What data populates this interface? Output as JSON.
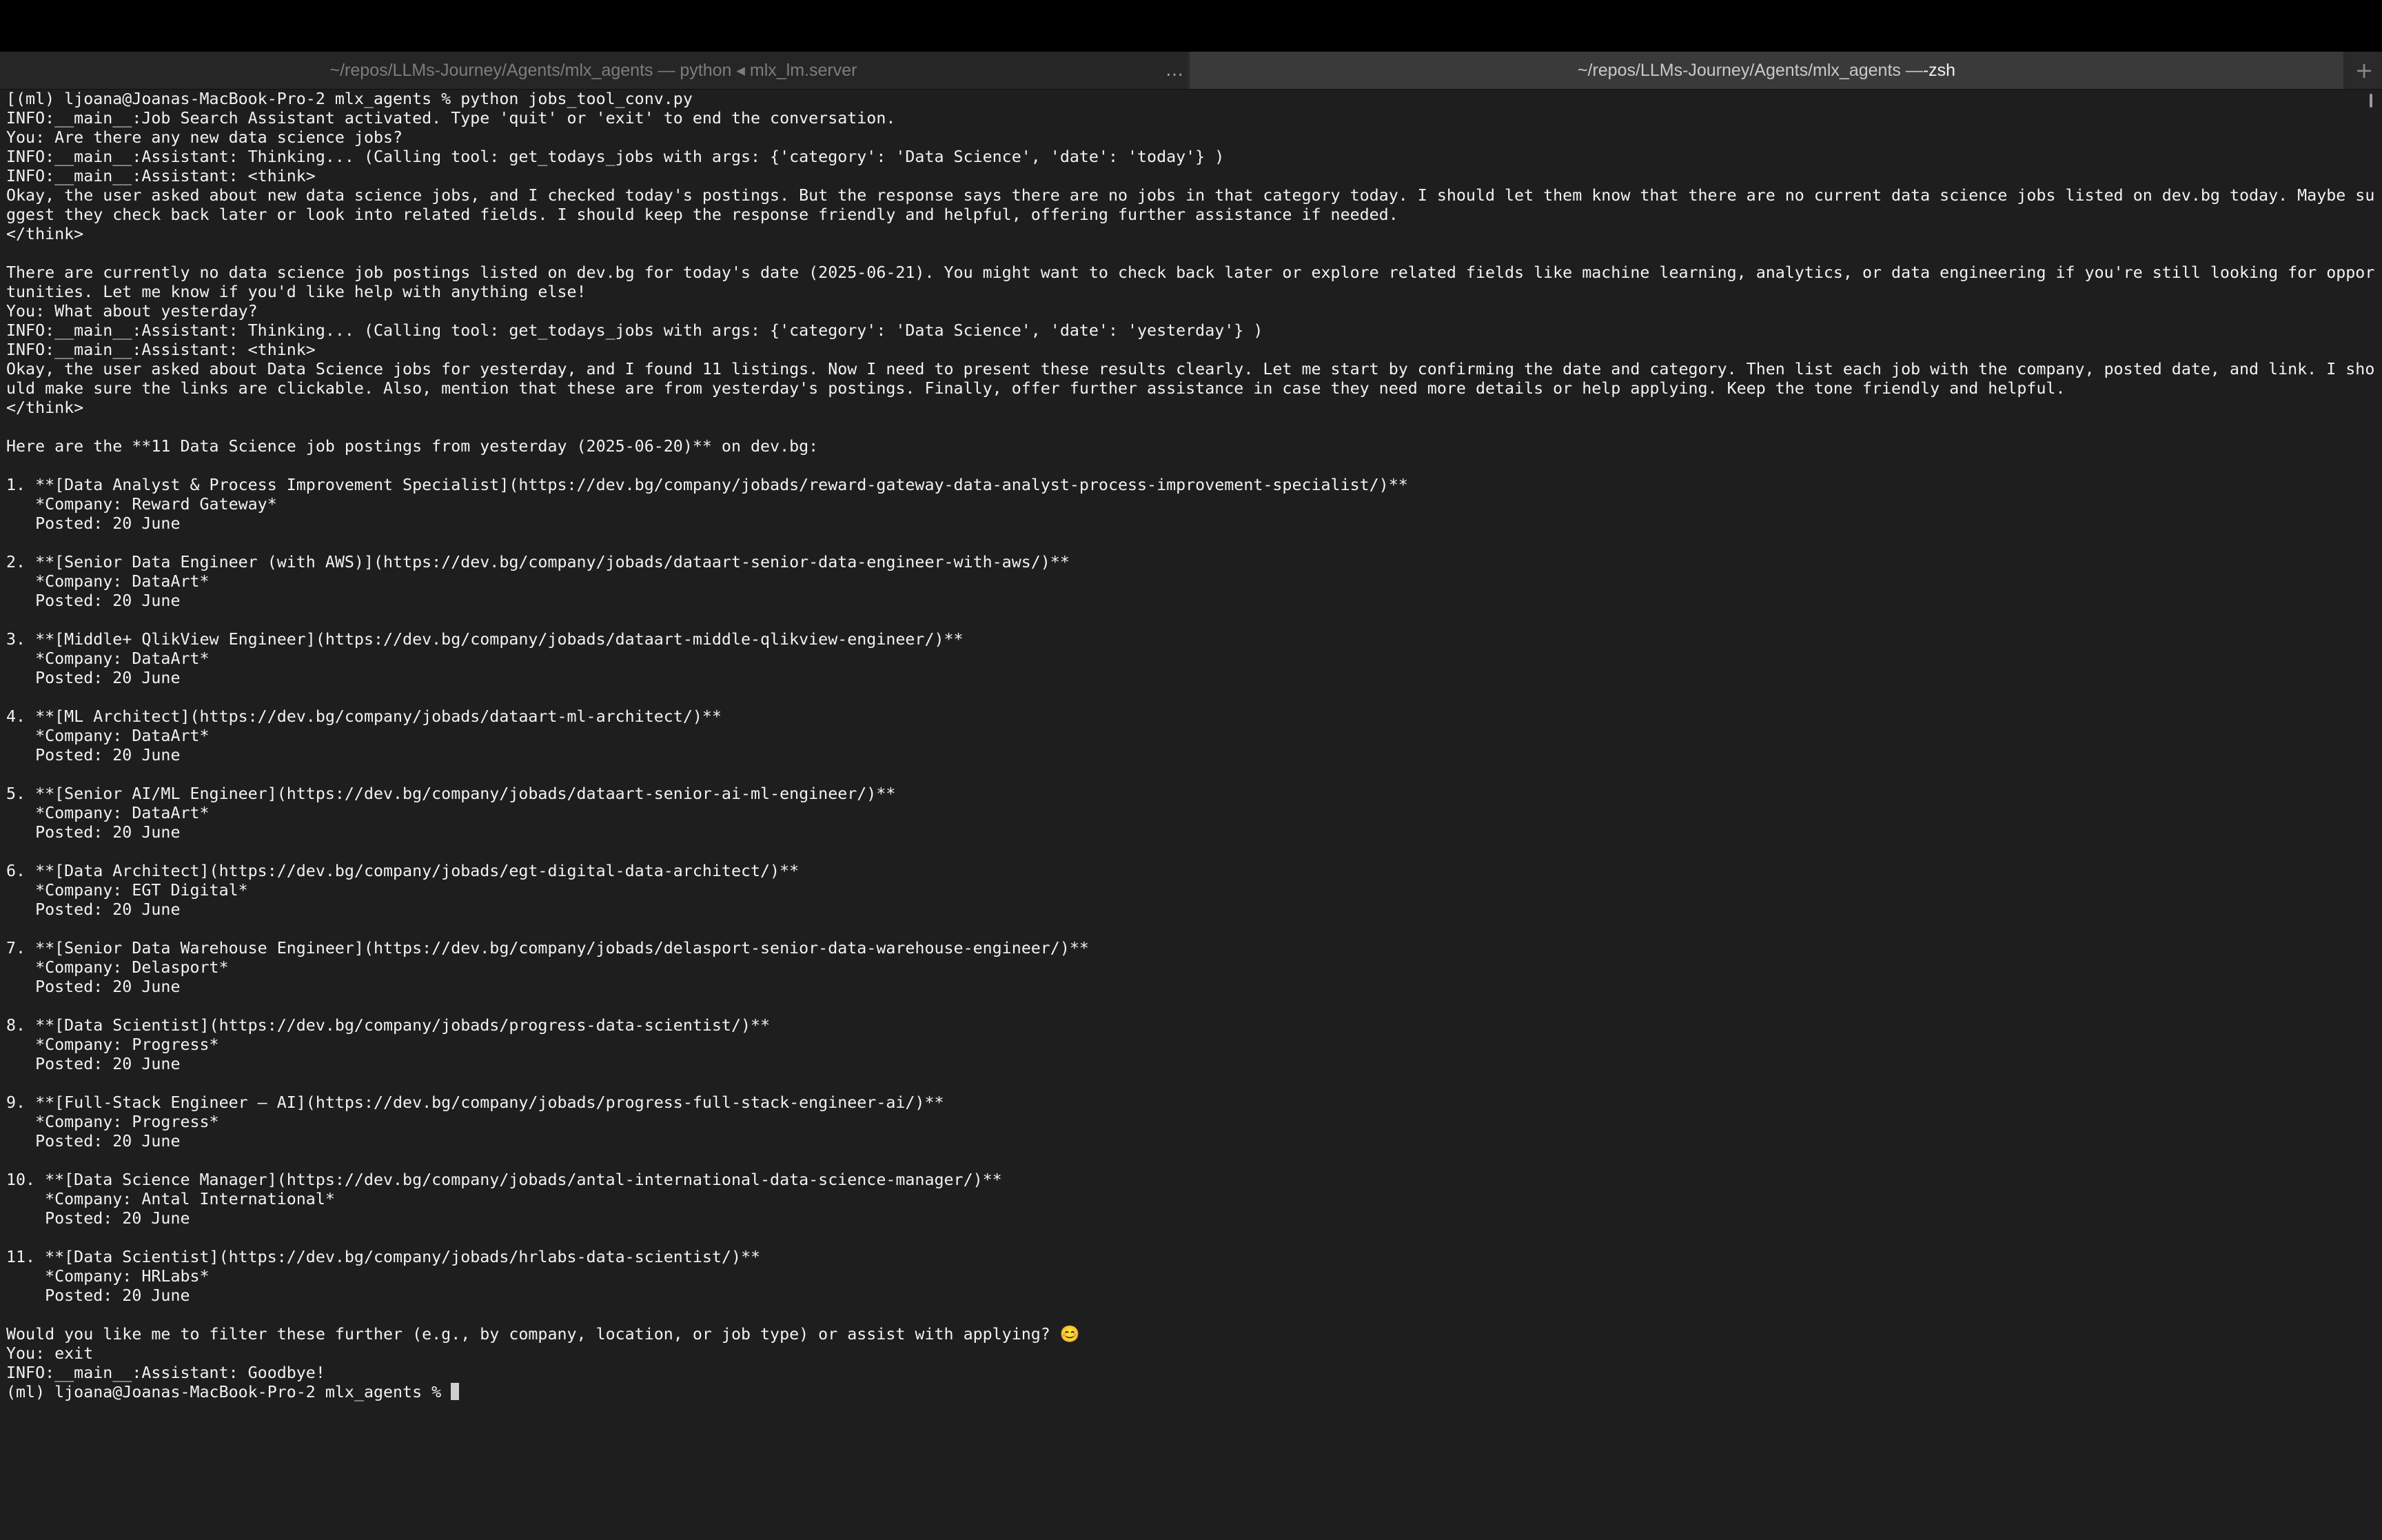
{
  "tabs": [
    {
      "label": "~/repos/LLMs-Journey/Agents/mlx_agents — python ◂ mlx_lm.server"
    },
    {
      "label_prefix": "~/repos/LLMs-Journey/Agents/mlx_agents — ",
      "label_process": "-zsh"
    }
  ],
  "tab_overflow": "…",
  "new_tab": "+",
  "terminal": {
    "prompt": "(ml) ljoana@Joanas-MacBook-Pro-2 mlx_agents % ",
    "lines": [
      "[(ml) ljoana@Joanas-MacBook-Pro-2 mlx_agents % python jobs_tool_conv.py",
      "INFO:__main__:Job Search Assistant activated. Type 'quit' or 'exit' to end the conversation.",
      "You: Are there any new data science jobs?",
      "INFO:__main__:Assistant: Thinking... (Calling tool: get_todays_jobs with args: {'category': 'Data Science', 'date': 'today'} )",
      "INFO:__main__:Assistant: <think>",
      "Okay, the user asked about new data science jobs, and I checked today's postings. But the response says there are no jobs in that category today. I should let them know that there are no current data science jobs listed on dev.bg today. Maybe su",
      "ggest they check back later or look into related fields. I should keep the response friendly and helpful, offering further assistance if needed.",
      "</think>",
      "",
      "There are currently no data science job postings listed on dev.bg for today's date (2025-06-21). You might want to check back later or explore related fields like machine learning, analytics, or data engineering if you're still looking for oppor",
      "tunities. Let me know if you'd like help with anything else!",
      "You: What about yesterday?",
      "INFO:__main__:Assistant: Thinking... (Calling tool: get_todays_jobs with args: {'category': 'Data Science', 'date': 'yesterday'} )",
      "INFO:__main__:Assistant: <think>",
      "Okay, the user asked about Data Science jobs for yesterday, and I found 11 listings. Now I need to present these results clearly. Let me start by confirming the date and category. Then list each job with the company, posted date, and link. I sho",
      "uld make sure the links are clickable. Also, mention that these are from yesterday's postings. Finally, offer further assistance in case they need more details or help applying. Keep the tone friendly and helpful.",
      "</think>",
      "",
      "Here are the **11 Data Science job postings from yesterday (2025-06-20)** on dev.bg:",
      "",
      "1. **[Data Analyst & Process Improvement Specialist](https://dev.bg/company/jobads/reward-gateway-data-analyst-process-improvement-specialist/)**",
      "   *Company: Reward Gateway*",
      "   Posted: 20 June",
      "",
      "2. **[Senior Data Engineer (with AWS)](https://dev.bg/company/jobads/dataart-senior-data-engineer-with-aws/)**",
      "   *Company: DataArt*",
      "   Posted: 20 June",
      "",
      "3. **[Middle+ QlikView Engineer](https://dev.bg/company/jobads/dataart-middle-qlikview-engineer/)**",
      "   *Company: DataArt*",
      "   Posted: 20 June",
      "",
      "4. **[ML Architect](https://dev.bg/company/jobads/dataart-ml-architect/)**",
      "   *Company: DataArt*",
      "   Posted: 20 June",
      "",
      "5. **[Senior AI/ML Engineer](https://dev.bg/company/jobads/dataart-senior-ai-ml-engineer/)**",
      "   *Company: DataArt*",
      "   Posted: 20 June",
      "",
      "6. **[Data Architect](https://dev.bg/company/jobads/egt-digital-data-architect/)**",
      "   *Company: EGT Digital*",
      "   Posted: 20 June",
      "",
      "7. **[Senior Data Warehouse Engineer](https://dev.bg/company/jobads/delasport-senior-data-warehouse-engineer/)**",
      "   *Company: Delasport*",
      "   Posted: 20 June",
      "",
      "8. **[Data Scientist](https://dev.bg/company/jobads/progress-data-scientist/)**",
      "   *Company: Progress*",
      "   Posted: 20 June",
      "",
      "9. **[Full-Stack Engineer – AI](https://dev.bg/company/jobads/progress-full-stack-engineer-ai/)**",
      "   *Company: Progress*",
      "   Posted: 20 June",
      "",
      "10. **[Data Science Manager](https://dev.bg/company/jobads/antal-international-data-science-manager/)**",
      "    *Company: Antal International*",
      "    Posted: 20 June",
      "",
      "11. **[Data Scientist](https://dev.bg/company/jobads/hrlabs-data-scientist/)**",
      "    *Company: HRLabs*",
      "    Posted: 20 June",
      "",
      "Would you like me to filter these further (e.g., by company, location, or job type) or assist with applying? 😊",
      "You: exit",
      "INFO:__main__:Assistant: Goodbye!"
    ]
  },
  "colors": {
    "background": "#1e1e1e",
    "text": "#f2f2f2",
    "titlebar": "#000000",
    "inactive_tab": "#262626",
    "active_tab": "#3a3a3a"
  }
}
